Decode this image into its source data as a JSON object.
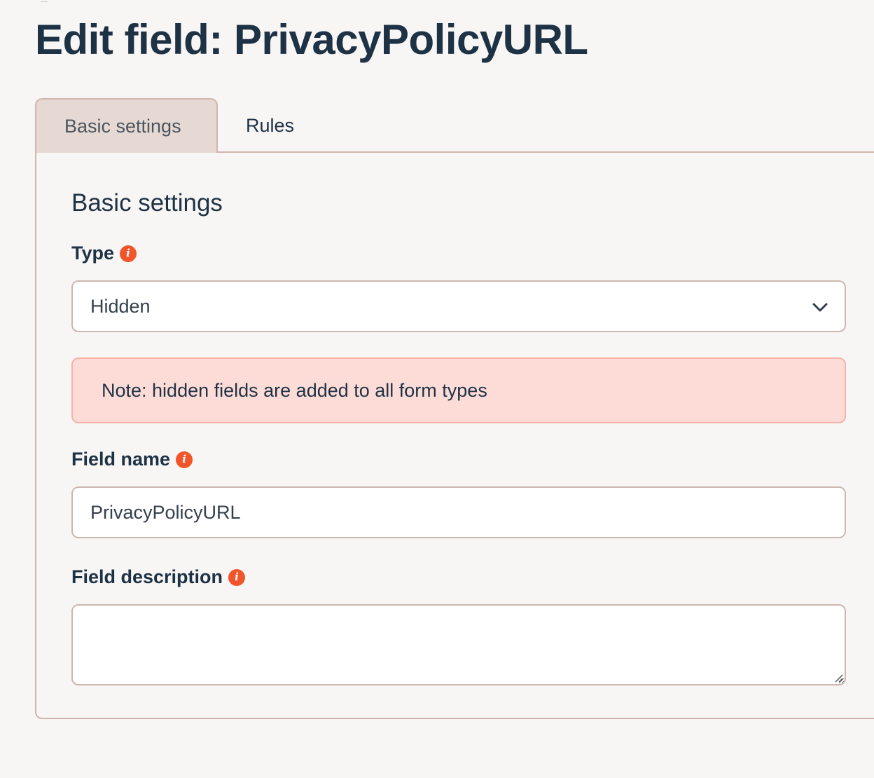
{
  "page": {
    "title": "Edit field: PrivacyPolicyURL"
  },
  "tabs": [
    {
      "label": "Basic settings",
      "active": true
    },
    {
      "label": "Rules",
      "active": false
    }
  ],
  "section": {
    "title": "Basic settings"
  },
  "type_field": {
    "label": "Type",
    "value": "Hidden",
    "info_icon": "info-icon",
    "dropdown_icon": "chevron-down-icon"
  },
  "note": {
    "text": "Note: hidden fields are added to all form types"
  },
  "field_name": {
    "label": "Field name",
    "value": "PrivacyPolicyURL",
    "info_icon": "info-icon"
  },
  "field_description": {
    "label": "Field description",
    "value": "",
    "info_icon": "info-icon"
  },
  "colors": {
    "heading": "#1e3246",
    "info_icon": "#f2552c",
    "note_background": "#fddcd7",
    "note_border": "#f7b3a8",
    "active_tab_background": "#e6d9d3",
    "border": "#d0b6ad",
    "page_background": "#f8f6f4"
  }
}
